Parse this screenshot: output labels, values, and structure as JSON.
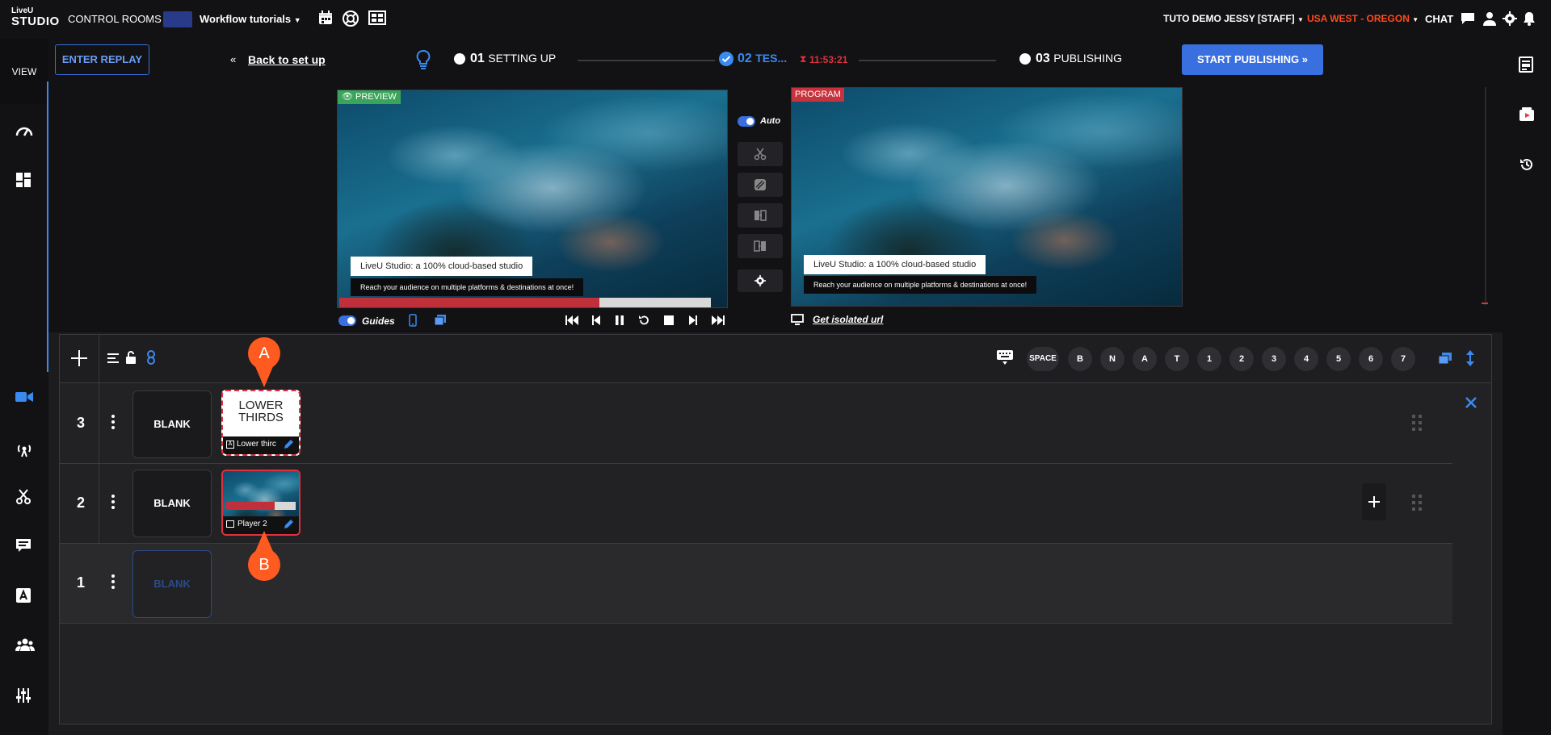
{
  "topbar": {
    "logo_top": "LiveU",
    "logo_bottom": "STUDIO",
    "control_rooms": "CONTROL ROOMS",
    "workflow": "Workflow tutorials",
    "account": "TUTO DEMO JESSY [STAFF]",
    "region": "USA WEST - OREGON",
    "chat": "CHAT",
    "region_color": "#ff4a1c",
    "icons": [
      "calendar-icon",
      "help-icon",
      "layout-icon",
      "chat-icon",
      "user-icon",
      "settings-icon"
    ]
  },
  "left_rail": {
    "view_label": "VIEW",
    "icons": [
      "dashboard-icon",
      "layout-grid-icon",
      "camera-icon",
      "broadcast-icon",
      "scissors-icon",
      "caption-icon",
      "text-icon",
      "users-icon",
      "sliders-icon"
    ]
  },
  "header": {
    "enter_replay": "ENTER REPLAY",
    "back_link": "Back to set up",
    "steps": [
      {
        "num": "01",
        "label": "SETTING UP"
      },
      {
        "num": "02",
        "label": "TES..."
      },
      {
        "num": "03",
        "label": "PUBLISHING"
      }
    ],
    "timer": "11:53:21",
    "start_publishing": "START PUBLISHING",
    "accent": "#3a6fe0"
  },
  "stage": {
    "preview_label": "PREVIEW",
    "program_label": "PROGRAM",
    "auto_label": "Auto",
    "guides_label": "Guides",
    "isolated_link": "Get isolated url",
    "lower_third_title": "LiveU Studio: a 100% cloud-based studio",
    "lower_third_sub": "Reach your audience on multiple platforms & destinations at once!",
    "progress_fraction": 0.7,
    "preview_color": "#3aa55a",
    "program_color": "#c8323c"
  },
  "toolbar": {
    "shortcuts": [
      "SPACE",
      "B",
      "N",
      "A",
      "T",
      "1",
      "2",
      "3",
      "4",
      "5",
      "6",
      "7"
    ]
  },
  "rows": [
    {
      "num": "3",
      "blank": "BLANK",
      "tile_title": "LOWER THIRDS",
      "tile_caption": "Lower thirc"
    },
    {
      "num": "2",
      "blank": "BLANK",
      "tile_caption": "Player 2"
    },
    {
      "num": "1",
      "blank": "BLANK"
    }
  ],
  "annotations": [
    "A",
    "B"
  ]
}
